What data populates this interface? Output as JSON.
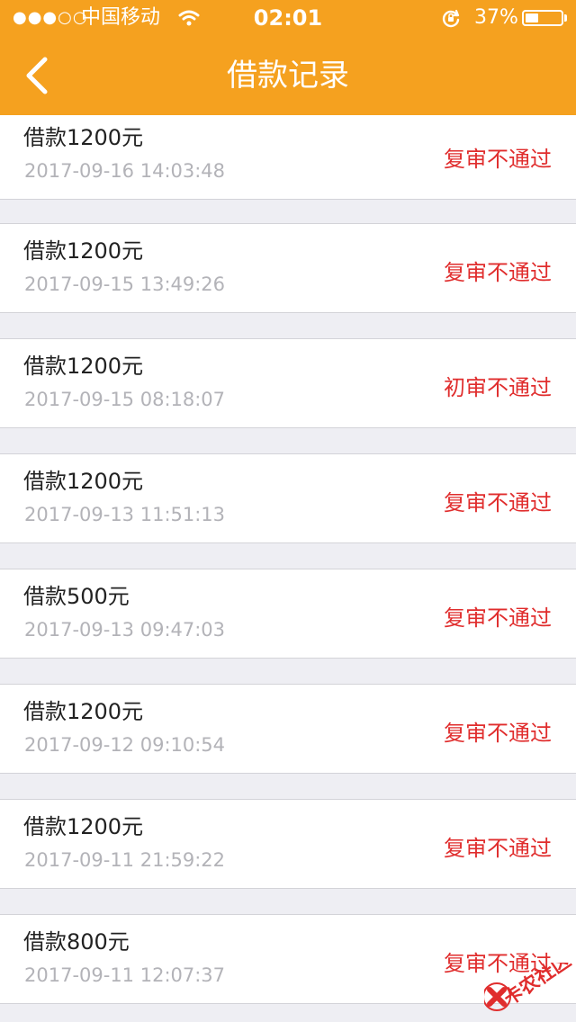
{
  "status_bar": {
    "signal": "●●●○○",
    "carrier": "中国移动",
    "time": "02:01",
    "battery": "37%",
    "battery_level": 0.37
  },
  "header": {
    "title": "借款记录",
    "background_color": "#f5a11f"
  },
  "records": [
    {
      "amount": "借款1200元",
      "time": "2017-09-16 14:03:48",
      "status": "复审不通过"
    },
    {
      "amount": "借款1200元",
      "time": "2017-09-15 13:49:26",
      "status": "复审不通过"
    },
    {
      "amount": "借款1200元",
      "time": "2017-09-15 08:18:07",
      "status": "初审不通过"
    },
    {
      "amount": "借款1200元",
      "time": "2017-09-13 11:51:13",
      "status": "复审不通过"
    },
    {
      "amount": "借款500元",
      "time": "2017-09-13 09:47:03",
      "status": "复审不通过"
    },
    {
      "amount": "借款1200元",
      "time": "2017-09-12 09:10:54",
      "status": "复审不通过"
    },
    {
      "amount": "借款1200元",
      "time": "2017-09-11 21:59:22",
      "status": "复审不通过"
    },
    {
      "amount": "借款800元",
      "time": "2017-09-11 12:07:37",
      "status": "复审不通过"
    }
  ],
  "watermark": {
    "text": "卡农社区",
    "icon": "kanong-logo-icon"
  },
  "colors": {
    "status_red": "#e02d2d",
    "background": "#eeeef3"
  }
}
